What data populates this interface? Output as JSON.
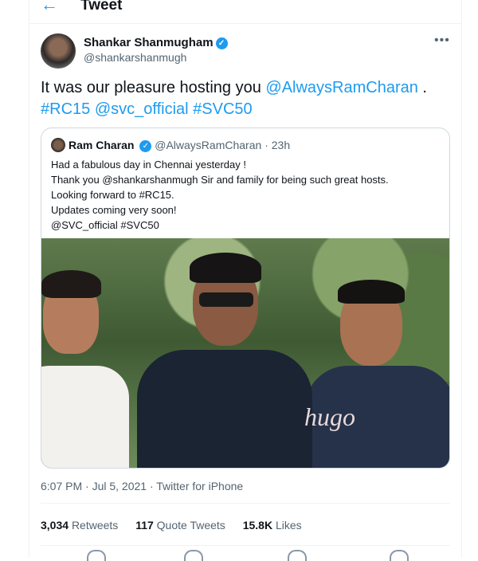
{
  "header": {
    "title": "Tweet",
    "back_icon": "←"
  },
  "author": {
    "name": "Shankar Shanmugham",
    "handle": "@shankarshanmugh",
    "verified_icon": "✓"
  },
  "tweet": {
    "text_pre": "It was our pleasure hosting you ",
    "mention": "@AlwaysRamCharan",
    "text_post": " .",
    "hashtag1": "#RC15",
    "mention2": "@svc_official",
    "hashtag2": "#SVC50"
  },
  "quote": {
    "name": "Ram Charan",
    "handle": "@AlwaysRamCharan",
    "time": "23h",
    "lines": [
      "Had a fabulous day in Chennai yesterday !",
      "Thank you @shankarshanmugh Sir and family for being such great hosts.",
      "Looking forward to #RC15.",
      "Updates coming very soon!",
      "@SVC_official #SVC50"
    ],
    "shirt_text": "hugo"
  },
  "meta": {
    "time": "6:07 PM · Jul 5, 2021 · ",
    "source": "Twitter for iPhone"
  },
  "stats": {
    "retweets": "3,034",
    "retweets_label": "Retweets",
    "quotes": "117",
    "quotes_label": "Quote Tweets",
    "likes": "15.8K",
    "likes_label": "Likes"
  },
  "colors": {
    "accent": "#1d9bf0",
    "muted": "#536471",
    "text": "#0f1419"
  },
  "icons": [
    "back-arrow-icon",
    "verified-badge-icon",
    "more-icon",
    "reply-icon",
    "retweet-icon",
    "like-icon",
    "share-icon"
  ]
}
